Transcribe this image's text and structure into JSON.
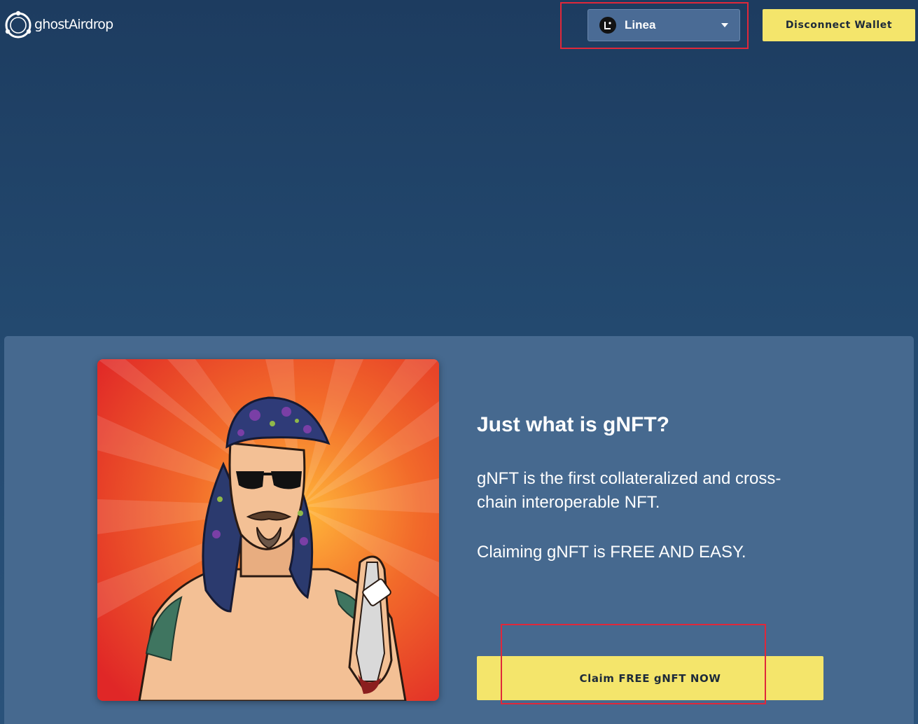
{
  "header": {
    "logo_text": "ghostAirdrop",
    "network_selector": {
      "selected": "Linea",
      "icon": "linea-network-icon"
    },
    "disconnect_label": "Disconnect Wallet"
  },
  "main": {
    "nft_image": "gnft-character-illustration",
    "heading": "Just what is gNFT?",
    "paragraph_1": "gNFT is the first collateralized and cross-chain interoperable NFT.",
    "paragraph_2": "Claiming gNFT is FREE AND EASY.",
    "claim_label": "Claim FREE gNFT NOW"
  },
  "colors": {
    "background": "#1d3c60",
    "panel": "#46698f",
    "accent_yellow": "#f4e56b",
    "highlight_red": "#e0283a"
  }
}
